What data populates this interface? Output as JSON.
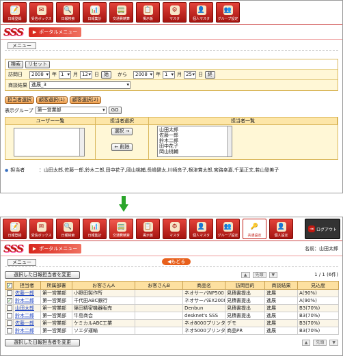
{
  "top_toolbar": [
    "日報登録",
    "受信ボックス",
    "日報検索",
    "日報集計",
    "交通費精算",
    "掲示板",
    "マスタ",
    "個人マスタ",
    "グループ設定"
  ],
  "bottom_toolbar": [
    "日報登録",
    "受信ボックス",
    "日報検索",
    "日報集計",
    "交通費精算",
    "掲示板",
    "マスタ",
    "個人マスタ",
    "グループ設定",
    "共通設定",
    "個人設定"
  ],
  "logout": "ログアウト",
  "logo": "SSS",
  "portal": "ポータルメニュー",
  "menu": "メニュー",
  "search": {
    "search_btn": "検索",
    "reset_btn": "リセット",
    "date_label": "訪問日",
    "from": {
      "y": "2008",
      "m": "1",
      "d": "12"
    },
    "to": {
      "y": "2008",
      "m": "1",
      "d": "25"
    },
    "year": "年",
    "month": "月",
    "day": "日",
    "today_btn": "始",
    "today_btn2": "終",
    "kara": "から",
    "result_label": "商談結果",
    "result_value": "進展_3"
  },
  "tabs": [
    "担当者選択",
    "顧客選択(1)",
    "顧客選択(2)"
  ],
  "group_label": "表示グループ",
  "group_value": "第一営業部",
  "go": "GO",
  "assign": {
    "h_users": "ユーザー一覧",
    "h_sel": "担当者選択",
    "h_list": "担当者一覧",
    "select_btn": "選択 →",
    "delete_btn": "← 削除",
    "assigned": [
      "山田太郎",
      "佐藤一郎",
      "鈴木二郎",
      "田中花子",
      "岡山桃輔"
    ]
  },
  "tanto_label": "担当者",
  "tanto_value": "：山田太郎,佐藤一郎,鈴木二郎,田中花子,岡山桃輔,長嶋健太,川崎良子,根津賞太郎,宮路幸嘉,千葉正文,若山登美子",
  "user_name": "名前：山田太郎",
  "back_btn": "もどる",
  "change_btn": "選択した日報担当者を変更",
  "prev": "先頭",
  "page_info": "1 / 1 (6件)",
  "columns": [
    "担当者",
    "所属部署",
    "お客さんA",
    "お客さんB",
    "商品名",
    "訪問目的",
    "商談結果",
    "見込度"
  ],
  "rows": [
    {
      "c": false,
      "name": "佐藤一郎",
      "dept": "第一営業部",
      "a": "小野田製作所",
      "b": "",
      "prod": "ネオサーバNP500",
      "purpose": "見積書提出",
      "result": "進展",
      "prob": "A(90%)"
    },
    {
      "c": true,
      "name": "鈴木二郎",
      "dept": "第一営業部",
      "a": "千代田ABC銀行",
      "b": "",
      "prod": "ネオサーバEX2008",
      "purpose": "見積書提出",
      "result": "進展",
      "prob": "A(90%)"
    },
    {
      "c": false,
      "name": "山田太郎",
      "dept": "第一営業部",
      "a": "篠田精密機器販売",
      "b": "",
      "prod": "Denbun",
      "purpose": "見積書提出",
      "result": "進展",
      "prob": "B3(70%)"
    },
    {
      "c": false,
      "name": "鈴木二郎",
      "dept": "第一営業部",
      "a": "牛島商会",
      "b": "",
      "prod": "desknet's SSS",
      "purpose": "見積書提出",
      "result": "進展",
      "prob": "B3(70%)"
    },
    {
      "c": false,
      "name": "佐藤一郎",
      "dept": "第一営業部",
      "a": "ケミカルABC工業",
      "b": "",
      "prod": "ネオ8000プリンタ",
      "purpose": "デモ",
      "result": "進展",
      "prob": "B3(70%)"
    },
    {
      "c": false,
      "name": "鈴木二郎",
      "dept": "第一営業部",
      "a": "ソエダ運輸",
      "b": "",
      "prod": "ネオ5000プリンタ",
      "purpose": "商品PR",
      "result": "進展",
      "prob": "B3(70%)"
    }
  ],
  "colors": {
    "accent": "#c01810",
    "header": "#fde0a0"
  }
}
